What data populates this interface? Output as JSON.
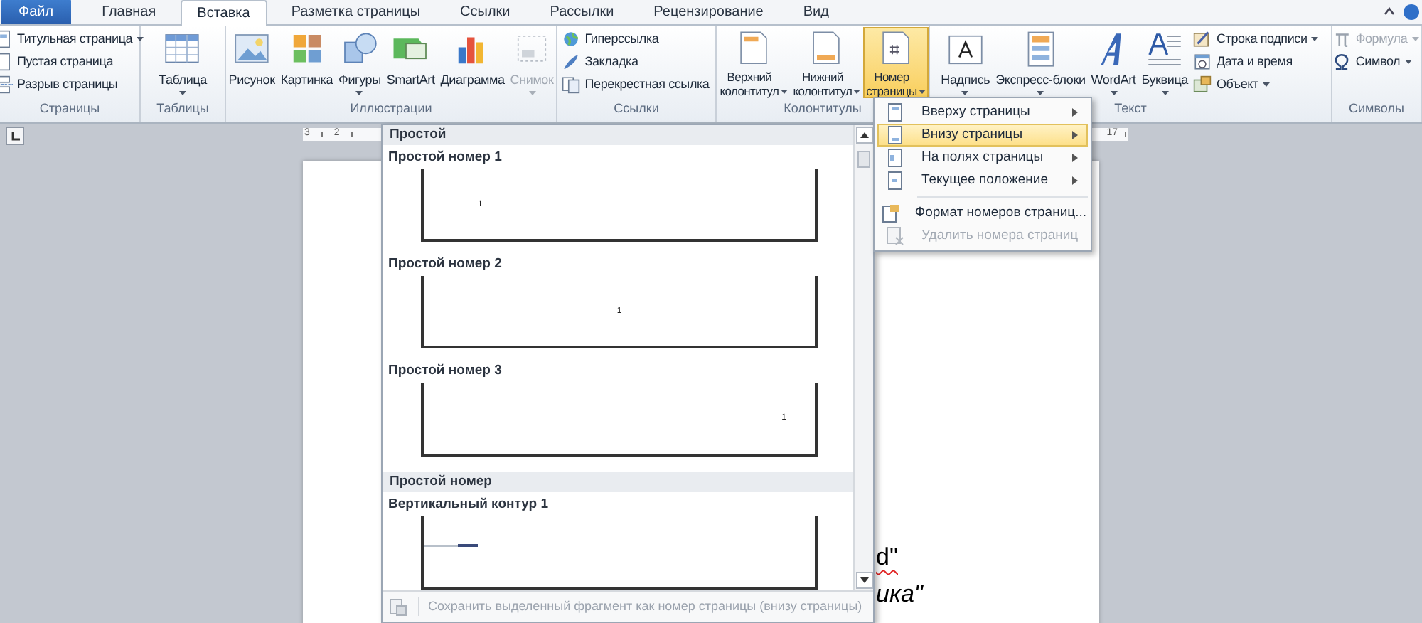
{
  "tabs": [
    {
      "label": "Файл",
      "kind": "file",
      "selected": false
    },
    {
      "label": "Главная",
      "kind": "tab",
      "selected": false
    },
    {
      "label": "Вставка",
      "kind": "tab",
      "selected": true
    },
    {
      "label": "Разметка страницы",
      "kind": "tab",
      "selected": false
    },
    {
      "label": "Ссылки",
      "kind": "tab",
      "selected": false
    },
    {
      "label": "Рассылки",
      "kind": "tab",
      "selected": false
    },
    {
      "label": "Рецензирование",
      "kind": "tab",
      "selected": false
    },
    {
      "label": "Вид",
      "kind": "tab",
      "selected": false
    }
  ],
  "ribbon_groups": [
    {
      "label": "Страницы",
      "items": [
        {
          "kind": "small",
          "label": "Титульная страница",
          "dropdown": true,
          "disabled": false,
          "open": false
        },
        {
          "kind": "small",
          "label": "Пустая страница",
          "dropdown": false,
          "disabled": false,
          "open": false
        },
        {
          "kind": "small",
          "label": "Разрыв страницы",
          "dropdown": false,
          "disabled": false,
          "open": false
        }
      ]
    },
    {
      "label": "Таблицы",
      "items": [
        {
          "kind": "large",
          "label": "Таблица",
          "dropdown": true,
          "disabled": false,
          "open": false
        }
      ]
    },
    {
      "label": "Иллюстрации",
      "items": [
        {
          "kind": "large",
          "label": "Рисунок",
          "dropdown": false,
          "disabled": false,
          "open": false
        },
        {
          "kind": "large",
          "label": "Картинка",
          "dropdown": false,
          "disabled": false,
          "open": false
        },
        {
          "kind": "large",
          "label": "Фигуры",
          "dropdown": true,
          "disabled": false,
          "open": false
        },
        {
          "kind": "large",
          "label": "SmartArt",
          "dropdown": false,
          "disabled": false,
          "open": false
        },
        {
          "kind": "large",
          "label": "Диаграмма",
          "dropdown": false,
          "disabled": false,
          "open": false
        },
        {
          "kind": "large",
          "label": "Снимок",
          "dropdown": true,
          "disabled": true,
          "open": false
        }
      ]
    },
    {
      "label": "Ссылки",
      "items": [
        {
          "kind": "small",
          "label": "Гиперссылка",
          "dropdown": false,
          "disabled": false,
          "open": false
        },
        {
          "kind": "small",
          "label": "Закладка",
          "dropdown": false,
          "disabled": false,
          "open": false
        },
        {
          "kind": "small",
          "label": "Перекрестная ссылка",
          "dropdown": false,
          "disabled": false,
          "open": false
        }
      ]
    },
    {
      "label": "Колонтитулы",
      "items": [
        {
          "kind": "large",
          "label": "Верхний\nколонтитул",
          "dropdown": true,
          "disabled": false,
          "open": false
        },
        {
          "kind": "large",
          "label": "Нижний\nколонтитул",
          "dropdown": true,
          "disabled": false,
          "open": false
        },
        {
          "kind": "large",
          "label": "Номер\nстраницы",
          "dropdown": true,
          "disabled": false,
          "open": true
        }
      ]
    },
    {
      "label": "Текст",
      "items": [
        {
          "kind": "large",
          "label": "Надпись",
          "dropdown": true,
          "disabled": false,
          "open": false
        },
        {
          "kind": "large",
          "label": "Экспресс-блоки",
          "dropdown": true,
          "disabled": false,
          "open": false
        },
        {
          "kind": "large",
          "label": "WordArt",
          "dropdown": true,
          "disabled": false,
          "open": false
        },
        {
          "kind": "large",
          "label": "Буквица",
          "dropdown": true,
          "disabled": false,
          "open": false
        },
        {
          "kind": "small",
          "label": "Строка подписи",
          "dropdown": true,
          "disabled": false,
          "open": false
        },
        {
          "kind": "small",
          "label": "Дата и время",
          "dropdown": false,
          "disabled": false,
          "open": false
        },
        {
          "kind": "small",
          "label": "Объект",
          "dropdown": true,
          "disabled": false,
          "open": false
        }
      ]
    },
    {
      "label": "Символы",
      "items": [
        {
          "kind": "small",
          "label": "Формула",
          "dropdown": true,
          "disabled": true,
          "open": false
        },
        {
          "kind": "small",
          "label": "Символ",
          "dropdown": true,
          "disabled": false,
          "open": false
        }
      ]
    }
  ],
  "ruler": {
    "left_labels": [
      "3",
      "2"
    ],
    "right_labels": [
      "17"
    ]
  },
  "page": {
    "lines": [
      {
        "text": "d\"",
        "italic": false,
        "misspelled": true
      },
      {
        "text": "ика\"",
        "italic": true,
        "misspelled": false
      }
    ]
  },
  "gallery": {
    "sections": [
      {
        "header": "Простой",
        "items": [
          {
            "kind": "left",
            "title": "Простой номер 1",
            "number": "1"
          },
          {
            "kind": "center",
            "title": "Простой номер 2",
            "number": "1"
          },
          {
            "kind": "right",
            "title": "Простой номер 3",
            "number": "1"
          }
        ]
      },
      {
        "header": "Простой номер",
        "items": [
          {
            "kind": "contour",
            "title": "Вертикальный контур 1"
          }
        ]
      }
    ],
    "footer": {
      "label": "Сохранить выделенный фрагмент как номер страницы (внизу страницы)",
      "disabled": true
    }
  },
  "menu": {
    "items": [
      {
        "kind": "item",
        "label": "Вверху страницы",
        "submenu": true,
        "selected": false,
        "disabled": false
      },
      {
        "kind": "item",
        "label": "Внизу страницы",
        "submenu": true,
        "selected": true,
        "disabled": false
      },
      {
        "kind": "item",
        "label": "На полях страницы",
        "submenu": true,
        "selected": false,
        "disabled": false
      },
      {
        "kind": "item",
        "label": "Текущее положение",
        "submenu": true,
        "selected": false,
        "disabled": false
      },
      {
        "kind": "separator"
      },
      {
        "kind": "item",
        "label": "Формат номеров страниц...",
        "submenu": false,
        "selected": false,
        "disabled": false
      },
      {
        "kind": "item",
        "label": "Удалить номера страниц",
        "submenu": false,
        "selected": false,
        "disabled": true
      }
    ]
  }
}
